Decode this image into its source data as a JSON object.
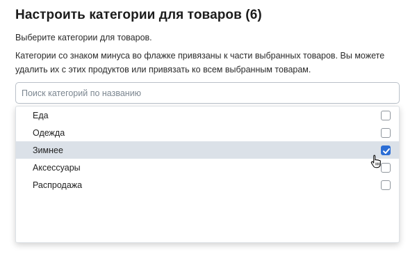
{
  "dialog": {
    "title": "Настроить категории для товаров (6)",
    "subtitle": "Выберите категории для товаров.",
    "description": "Категории со знаком минуса во флажке привязаны к части выбранных товаров. Вы можете удалить их с этих продуктов или привязать ко всем выбранным товарам."
  },
  "search": {
    "placeholder": "Поиск категорий по названию",
    "value": ""
  },
  "categories": [
    {
      "label": "Еда",
      "checked": false,
      "highlighted": false
    },
    {
      "label": "Одежда",
      "checked": false,
      "highlighted": false
    },
    {
      "label": "Зимнее",
      "checked": true,
      "highlighted": true
    },
    {
      "label": "Аксессуары",
      "checked": false,
      "highlighted": false
    },
    {
      "label": "Распродажа",
      "checked": false,
      "highlighted": false
    }
  ],
  "colors": {
    "accent": "#2c6ed5",
    "highlight_row": "#dbe1e8"
  },
  "icons": {
    "checkmark": "check-icon",
    "cursor": "hand-pointer-icon"
  }
}
